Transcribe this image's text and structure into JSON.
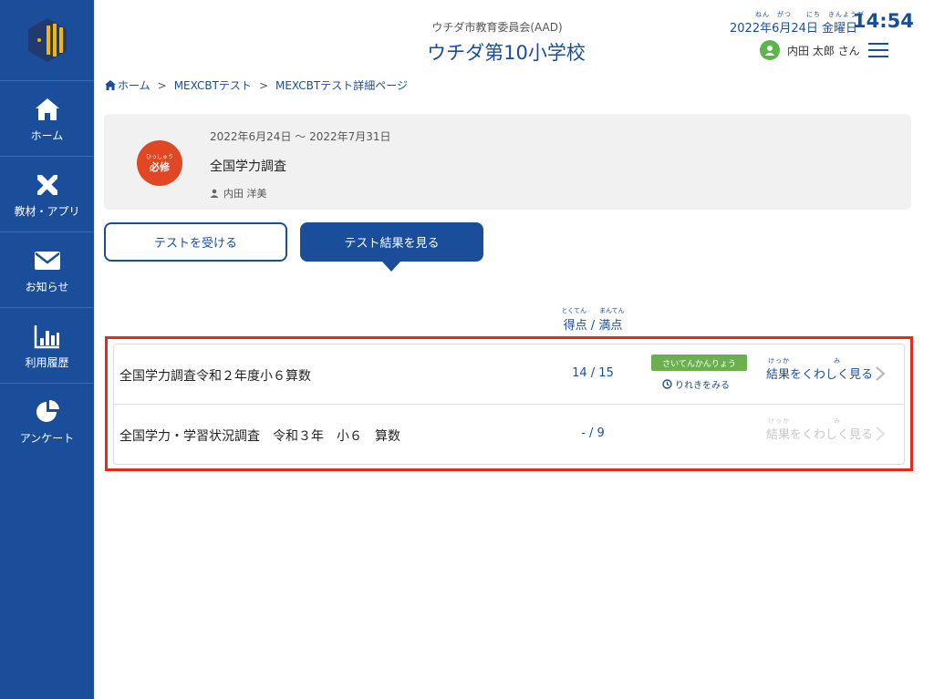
{
  "sidebar": {
    "items": [
      {
        "label": "ホーム"
      },
      {
        "label": "教材・アプリ"
      },
      {
        "label": "お知らせ"
      },
      {
        "label": "利用履歴"
      },
      {
        "label": "アンケート"
      }
    ]
  },
  "header": {
    "org": "ウチダ市教育委員会(AAD)",
    "school": "ウチダ第10小学校",
    "date": "2022年6月24日 金曜日",
    "date_ruby": "ねん　がつ　　にち　きんようび",
    "time": "14:54",
    "user": "内田 太郎 さん"
  },
  "breadcrumb": {
    "home": "ホーム",
    "sep": ">",
    "item1": "MEXCBTテスト",
    "item2": "MEXCBTテスト詳細ページ"
  },
  "test": {
    "badge_ruby": "ひっしゅう",
    "badge": "必修",
    "period": "2022年6月24日 〜 2022年7月31日",
    "title": "全国学力調査",
    "teacher": "内田 洋美"
  },
  "tabs": {
    "take": "テストを受ける",
    "results": "テスト結果を見る"
  },
  "score_header": {
    "ruby": "とくてん　　まんてん",
    "label": "得点 / 満点"
  },
  "results": [
    {
      "name": "全国学力調査令和２年度小６算数",
      "score": "14 / 15",
      "tag": "さいてんかんりょう",
      "history": "りれきをみる",
      "detail_ruby": "けっか　　　　　　み",
      "detail": "結果をくわしく見る"
    },
    {
      "name": "全国学力・学習状況調査　令和３年　小６　算数",
      "score": "- / 9",
      "detail_ruby": "けっか　　　　　　み",
      "detail": "結果をくわしく見る"
    }
  ],
  "colors": {
    "brand": "#1a4e9a",
    "required_badge": "#e04722",
    "tag_green": "#6cb04d",
    "highlight_border": "#e02b1d"
  }
}
